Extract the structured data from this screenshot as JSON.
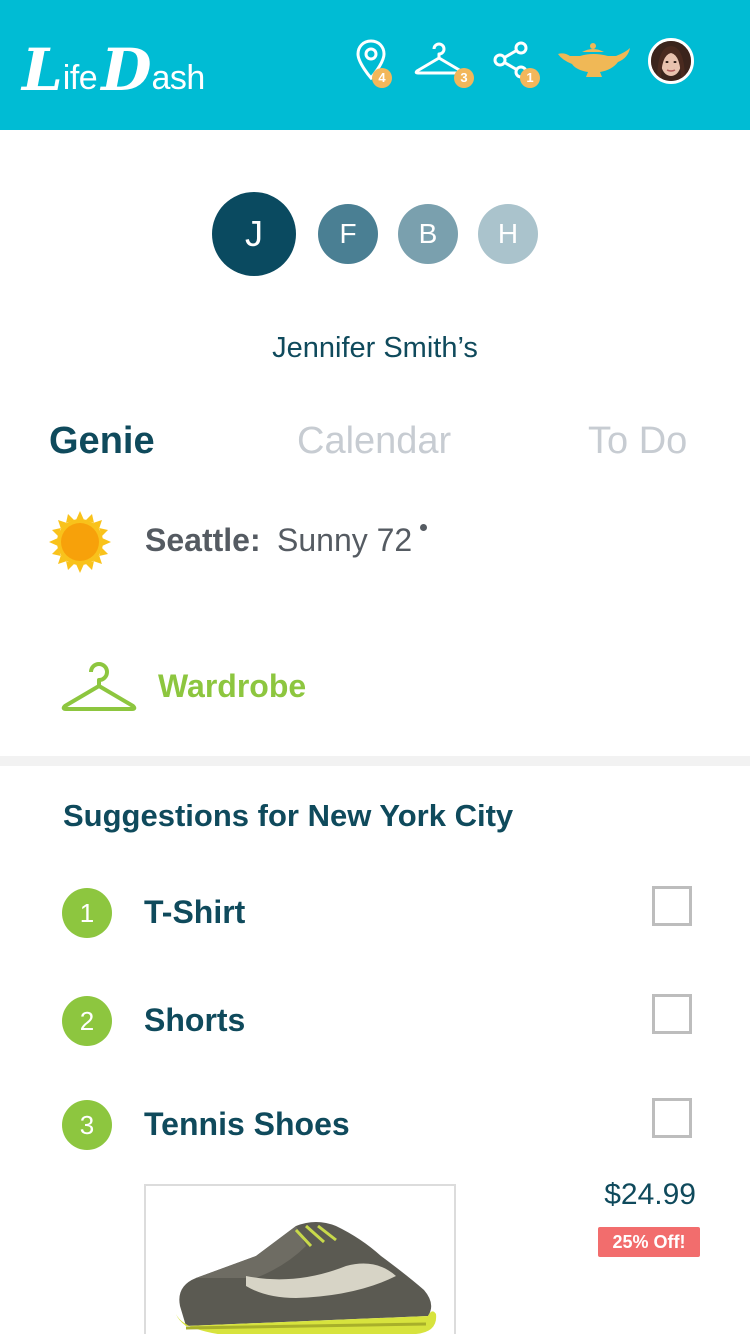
{
  "header": {
    "logo": {
      "first_big": "L",
      "first_small": "ife",
      "second_big": "D",
      "second_small": "ash"
    },
    "icons": [
      {
        "name": "location-pin-icon",
        "badge": "4"
      },
      {
        "name": "hanger-icon",
        "badge": "3"
      },
      {
        "name": "share-icon",
        "badge": "1"
      },
      {
        "name": "genie-lamp-icon"
      }
    ],
    "colors": {
      "background": "#00bcd4",
      "badge": "#f2b75b",
      "lamp": "#f0b856"
    }
  },
  "profiles": [
    {
      "initial": "J",
      "color": "#0a4a60",
      "selected": true
    },
    {
      "initial": "F",
      "color": "#4a7f93"
    },
    {
      "initial": "B",
      "color": "#7aa0ae"
    },
    {
      "initial": "H",
      "color": "#aac3cc"
    }
  ],
  "owner_label": "Jennifer Smith’s",
  "tabs": [
    {
      "label": "Genie",
      "active": true
    },
    {
      "label": "Calendar",
      "active": false
    },
    {
      "label": "To Do",
      "active": false
    }
  ],
  "weather": {
    "icon": "sun-icon",
    "city": "Seattle:",
    "condition": "Sunny 72"
  },
  "wardrobe": {
    "icon": "hanger-icon",
    "label": "Wardrobe",
    "color": "#8dc63f"
  },
  "suggestions": {
    "title": "Suggestions for New York City",
    "items": [
      {
        "number": "1",
        "name": "T-Shirt",
        "checked": false
      },
      {
        "number": "2",
        "name": "Shorts",
        "checked": false
      },
      {
        "number": "3",
        "name": "Tennis Shoes",
        "checked": false
      }
    ]
  },
  "product": {
    "image": "sneaker-image",
    "price": "$24.99",
    "discount": "25% Off!"
  }
}
